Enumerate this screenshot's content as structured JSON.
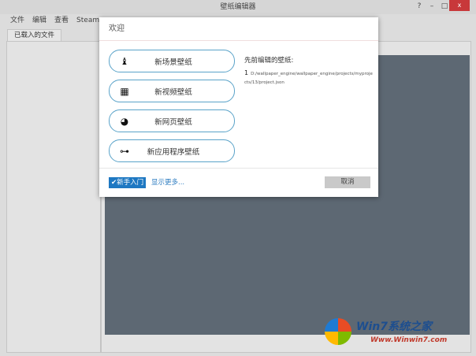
{
  "window": {
    "title": "壁纸编辑器",
    "help": "?",
    "minimize": "–",
    "maximize": "□",
    "close": "x"
  },
  "menu": [
    "文件",
    "编辑",
    "查看",
    "Steam"
  ],
  "tab": "已载入的文件",
  "dialog": {
    "title": "欢迎",
    "buttons": [
      {
        "label": "新场景壁纸",
        "icon": "scene-icon"
      },
      {
        "label": "新视频壁纸",
        "icon": "film-icon"
      },
      {
        "label": "新网页壁纸",
        "icon": "globe-icon"
      },
      {
        "label": "新应用程序壁纸",
        "icon": "gamepad-icon"
      }
    ],
    "recent_title": "先前编辑的壁纸:",
    "recent": [
      {
        "num": "1",
        "path": "D:/wallpaper_engine/wallpaper_engine/projects/myprojects/13/project.json"
      }
    ],
    "guide": "✔新手入门",
    "more": "显示更多...",
    "cancel": "取消"
  },
  "watermark": {
    "text": "Win7系统之家",
    "url": "Www.Winwin7.com"
  }
}
